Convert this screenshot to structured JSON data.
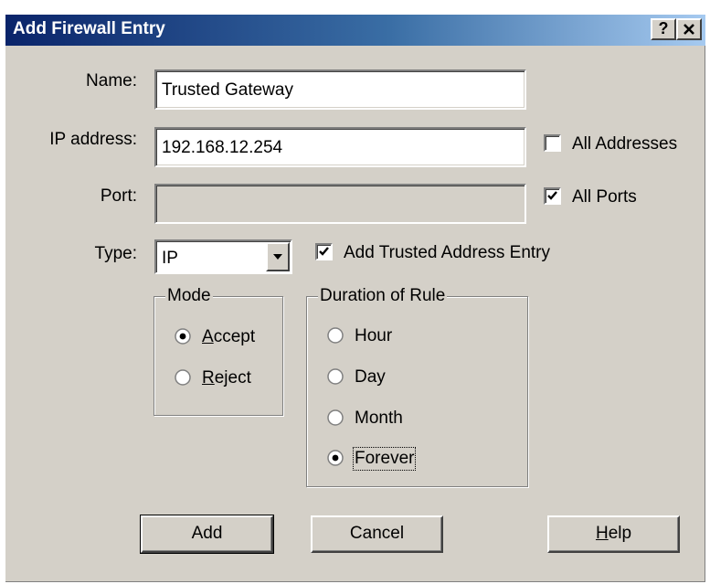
{
  "window": {
    "title": "Add Firewall Entry",
    "help_btn": "?",
    "close_btn": "✕"
  },
  "fields": {
    "name_label": "Name:",
    "name_value": "Trusted Gateway",
    "ip_label": "IP address:",
    "ip_value": "192.168.12.254",
    "port_label": "Port:",
    "port_value": "",
    "type_label": "Type:",
    "type_value": "IP"
  },
  "checkboxes": {
    "all_addresses": {
      "label": "All Addresses",
      "checked": false
    },
    "all_ports": {
      "label": "All Ports",
      "checked": true
    },
    "trusted_entry": {
      "label": "Add Trusted Address Entry",
      "checked": true
    }
  },
  "mode": {
    "legend": "Mode",
    "accept_first": "A",
    "accept_rest": "ccept",
    "reject_first": "R",
    "reject_rest": "eject",
    "selected": "Accept"
  },
  "duration": {
    "legend": "Duration of Rule",
    "options": [
      "Hour",
      "Day",
      "Month",
      "Forever"
    ],
    "selected": "Forever"
  },
  "buttons": {
    "add": "Add",
    "cancel": "Cancel",
    "help_first": "H",
    "help_rest": "elp"
  }
}
